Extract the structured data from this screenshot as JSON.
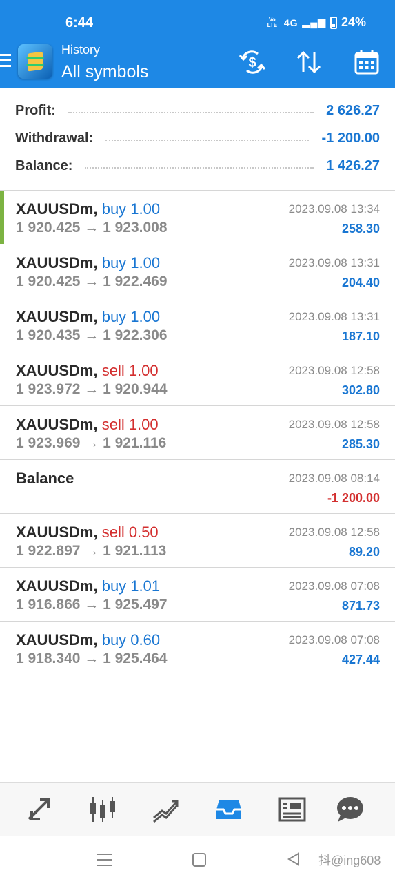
{
  "status_bar": {
    "time": "6:44",
    "volte": "Vo LTE",
    "network": "4G",
    "battery": "24%"
  },
  "app_bar": {
    "label": "History",
    "title": "All symbols"
  },
  "summary": [
    {
      "label": "Profit:",
      "value": "2 626.27"
    },
    {
      "label": "Withdrawal:",
      "value": "-1 200.00"
    },
    {
      "label": "Balance:",
      "value": "1 426.27"
    }
  ],
  "deals": [
    {
      "symbol": "XAUUSDm,",
      "action": "buy 1.00",
      "prices": "1 920.425 → 1 923.008",
      "time": "2023.09.08 13:34",
      "profit": "258.30"
    },
    {
      "symbol": "XAUUSDm,",
      "action": "buy 1.00",
      "prices": "1 920.425 → 1 922.469",
      "time": "2023.09.08 13:31",
      "profit": "204.40"
    },
    {
      "symbol": "XAUUSDm,",
      "action": "buy 1.00",
      "prices": "1 920.435 → 1 922.306",
      "time": "2023.09.08 13:31",
      "profit": "187.10"
    },
    {
      "symbol": "XAUUSDm,",
      "action": "sell 1.00",
      "prices": "1 923.972 → 1 920.944",
      "time": "2023.09.08 12:58",
      "profit": "302.80"
    },
    {
      "symbol": "XAUUSDm,",
      "action": "sell 1.00",
      "prices": "1 923.969 → 1 921.116",
      "time": "2023.09.08 12:58",
      "profit": "285.30"
    },
    {
      "symbol": "Balance",
      "action": "",
      "prices": "",
      "time": "2023.09.08 08:14",
      "profit": "-1 200.00"
    },
    {
      "symbol": "XAUUSDm,",
      "action": "sell 0.50",
      "prices": "1 922.897 → 1 921.113",
      "time": "2023.09.08 12:58",
      "profit": "89.20"
    },
    {
      "symbol": "XAUUSDm,",
      "action": "buy 1.01",
      "prices": "1 916.866 → 1 925.497",
      "time": "2023.09.08 07:08",
      "profit": "871.73"
    },
    {
      "symbol": "XAUUSDm,",
      "action": "buy 0.60",
      "prices": "1 918.340 → 1 925.464",
      "time": "2023.09.08 07:08",
      "profit": "427.44"
    }
  ],
  "bottom_nav": [
    "quotes-icon",
    "chart-icon",
    "trade-icon",
    "history-icon",
    "news-icon",
    "chat-icon"
  ],
  "watermark": "抖@ing608",
  "colors": {
    "app_bar": "#1e88e5",
    "buy": "#1976d2",
    "sell": "#d32f2f",
    "active_marker": "#7cb342"
  }
}
